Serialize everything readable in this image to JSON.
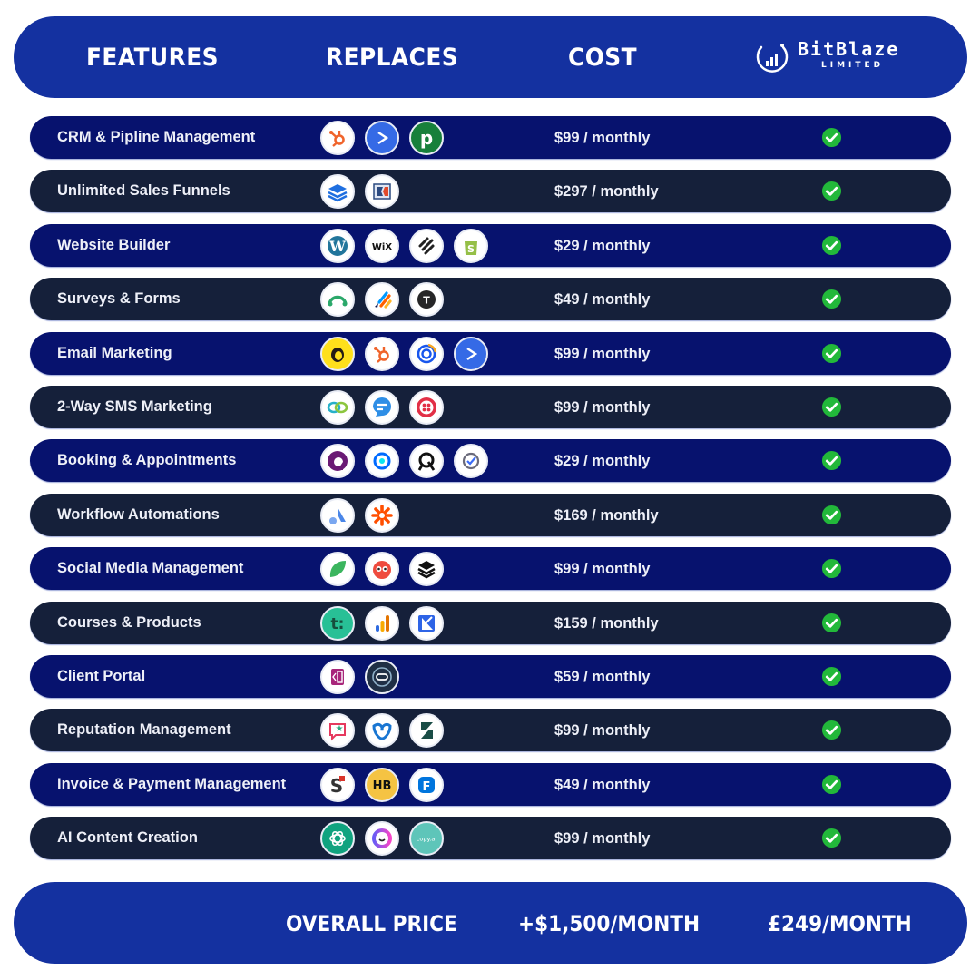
{
  "header": {
    "features_label": "FEATURES",
    "replaces_label": "REPLACES",
    "cost_label": "COST",
    "brand": {
      "name": "BitBlaze",
      "subtitle": "LIMITED",
      "logo_icon": "bar-chart-circle-icon"
    }
  },
  "colors": {
    "header_footer_bg": "#1431a0",
    "row_navy": "#07126e",
    "row_slate": "#15203a",
    "check_green": "#22b83a",
    "text": "#ffffff"
  },
  "rows": [
    {
      "feature": "CRM & Pipline Management",
      "replaces": [
        "hubspot-icon",
        "activecampaign-icon",
        "pipedrive-icon"
      ],
      "cost": "$99 / monthly",
      "included": true
    },
    {
      "feature": "Unlimited Sales Funnels",
      "replaces": [
        "leadpages-icon",
        "clickfunnels-icon"
      ],
      "cost": "$297 / monthly",
      "included": true
    },
    {
      "feature": "Website Builder",
      "replaces": [
        "wordpress-icon",
        "wix-icon",
        "squarespace-icon",
        "shopify-icon"
      ],
      "cost": "$29 / monthly",
      "included": true
    },
    {
      "feature": "Surveys & Forms",
      "replaces": [
        "surveymonkey-icon",
        "jotform-icon",
        "typeform-icon"
      ],
      "cost": "$49 / monthly",
      "included": true
    },
    {
      "feature": "Email Marketing",
      "replaces": [
        "mailchimp-icon",
        "hubspot-icon",
        "constantcontact-icon",
        "activecampaign-icon"
      ],
      "cost": "$99 / monthly",
      "included": true
    },
    {
      "feature": "2-Way SMS Marketing",
      "replaces": [
        "chain-link-icon",
        "message-bubble-icon",
        "twilio-icon"
      ],
      "cost": "$99 / monthly",
      "included": true
    },
    {
      "feature": "Booking & Appointments",
      "replaces": [
        "acuity-icon",
        "calendly-icon",
        "scheduler-icon",
        "checkmark-clock-icon"
      ],
      "cost": "$29 / monthly",
      "included": true
    },
    {
      "feature": "Workflow Automations",
      "replaces": [
        "activecampaign-a-icon",
        "zapier-icon"
      ],
      "cost": "$169 / monthly",
      "included": true
    },
    {
      "feature": "Social Media Management",
      "replaces": [
        "sprout-social-icon",
        "hootsuite-icon",
        "buffer-icon"
      ],
      "cost": "$99 / monthly",
      "included": true
    },
    {
      "feature": "Courses & Products",
      "replaces": [
        "teachable-icon",
        "analytics-bars-icon",
        "kajabi-icon"
      ],
      "cost": "$159 / monthly",
      "included": true
    },
    {
      "feature": "Client Portal",
      "replaces": [
        "portal-book-icon",
        "client-card-icon"
      ],
      "cost": "$59 / monthly",
      "included": true
    },
    {
      "feature": "Reputation Management",
      "replaces": [
        "review-star-icon",
        "birdeye-icon",
        "reputation-icon"
      ],
      "cost": "$99 / monthly",
      "included": true
    },
    {
      "feature": "Invoice & Payment Management",
      "replaces": [
        "s-payments-icon",
        "honeybook-icon",
        "freshbooks-icon"
      ],
      "cost": "$49 / monthly",
      "included": true
    },
    {
      "feature": "AI Content Creation",
      "replaces": [
        "chatgpt-icon",
        "jasper-icon",
        "copyai-icon"
      ],
      "cost": "$99 / monthly",
      "included": true
    }
  ],
  "footer": {
    "overall_label": "OVERALL PRICE",
    "competitor_total": "+$1,500/MONTH",
    "brand_price": "£249/MONTH"
  }
}
